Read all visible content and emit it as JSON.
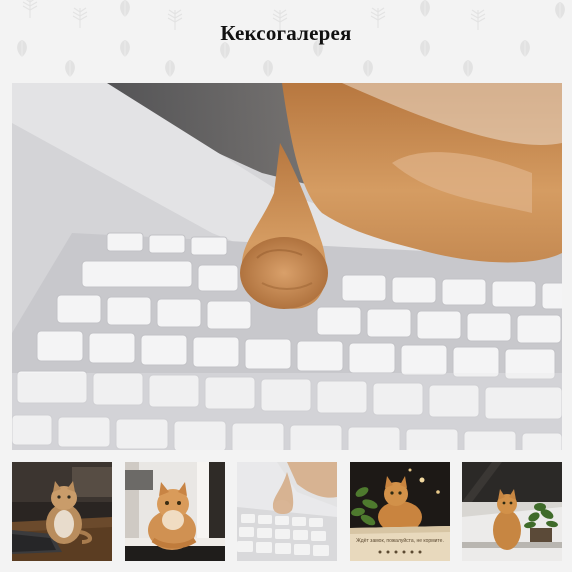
{
  "page": {
    "title": "Кексогалерея"
  },
  "main_photo": {
    "subject": "cat-paw-on-keyboard"
  },
  "thumbnails": [
    {
      "subject": "cat-sitting-by-laptop",
      "selected": false
    },
    {
      "subject": "cat-on-windowsill",
      "selected": false
    },
    {
      "subject": "cat-paw-on-keyboard",
      "selected": true
    },
    {
      "subject": "cat-in-box-with-plant",
      "selected": false
    },
    {
      "subject": "cat-on-shelf-with-plant",
      "selected": false
    }
  ],
  "thumbnail_4_caption": "Ждёт замок, пожалуйста, не кормите.",
  "colors": {
    "background": "#f3f3f3",
    "title": "#111111",
    "cat_fur": "#c98a4e",
    "keyboard": "#eeeeee"
  }
}
